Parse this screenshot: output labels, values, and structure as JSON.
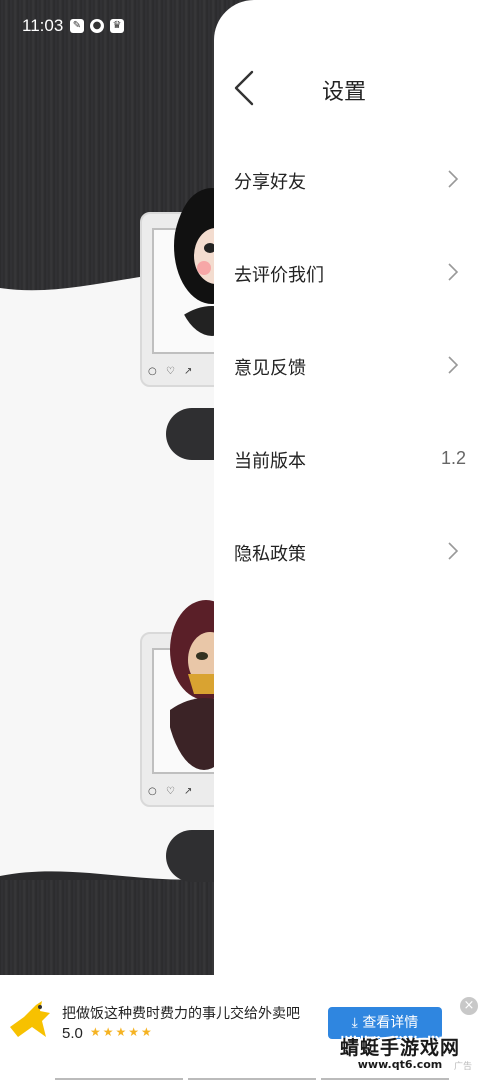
{
  "status_bar": {
    "time": "11:03"
  },
  "background_app": {
    "button_glyph_1": "⍲",
    "button_glyph_2": "⍲"
  },
  "settings": {
    "title": "设置",
    "items": [
      {
        "label": "分享好友",
        "type": "link"
      },
      {
        "label": "去评价我们",
        "type": "link"
      },
      {
        "label": "意见反馈",
        "type": "link"
      },
      {
        "label": "当前版本",
        "type": "value",
        "value": "1.2"
      },
      {
        "label": "隐私政策",
        "type": "link"
      }
    ]
  },
  "ad": {
    "title": "把做饭这种费时费力的事儿交给外卖吧",
    "rating": "5.0",
    "stars": "★★★★★",
    "cta": "查看详情",
    "tag": "广告"
  },
  "watermark": {
    "name": "蜻蜓手游戏网",
    "url": "www.qt6.com"
  },
  "colors": {
    "accent": "#2f86e0",
    "star": "#f5b323",
    "bg_dark": "#2b2b2d"
  }
}
